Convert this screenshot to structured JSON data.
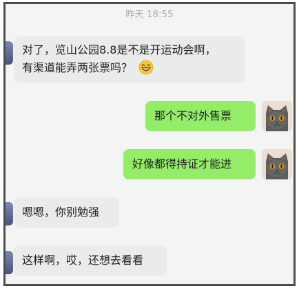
{
  "chat": {
    "timestamp": "昨天 18:55",
    "messages": [
      {
        "side": "in",
        "lines": [
          "对了，览山公园8.8是不是开运动会啊，",
          "有渠道能弄两张票吗？"
        ],
        "emoji": "grinning-face-emoji"
      },
      {
        "side": "out",
        "text": "那个不对外售票"
      },
      {
        "side": "out",
        "text": "好像都得持证才能进"
      },
      {
        "side": "in",
        "text": "嗯嗯，你别勉强"
      },
      {
        "side": "in",
        "text": "这样啊，哎，还想去看看"
      }
    ]
  }
}
